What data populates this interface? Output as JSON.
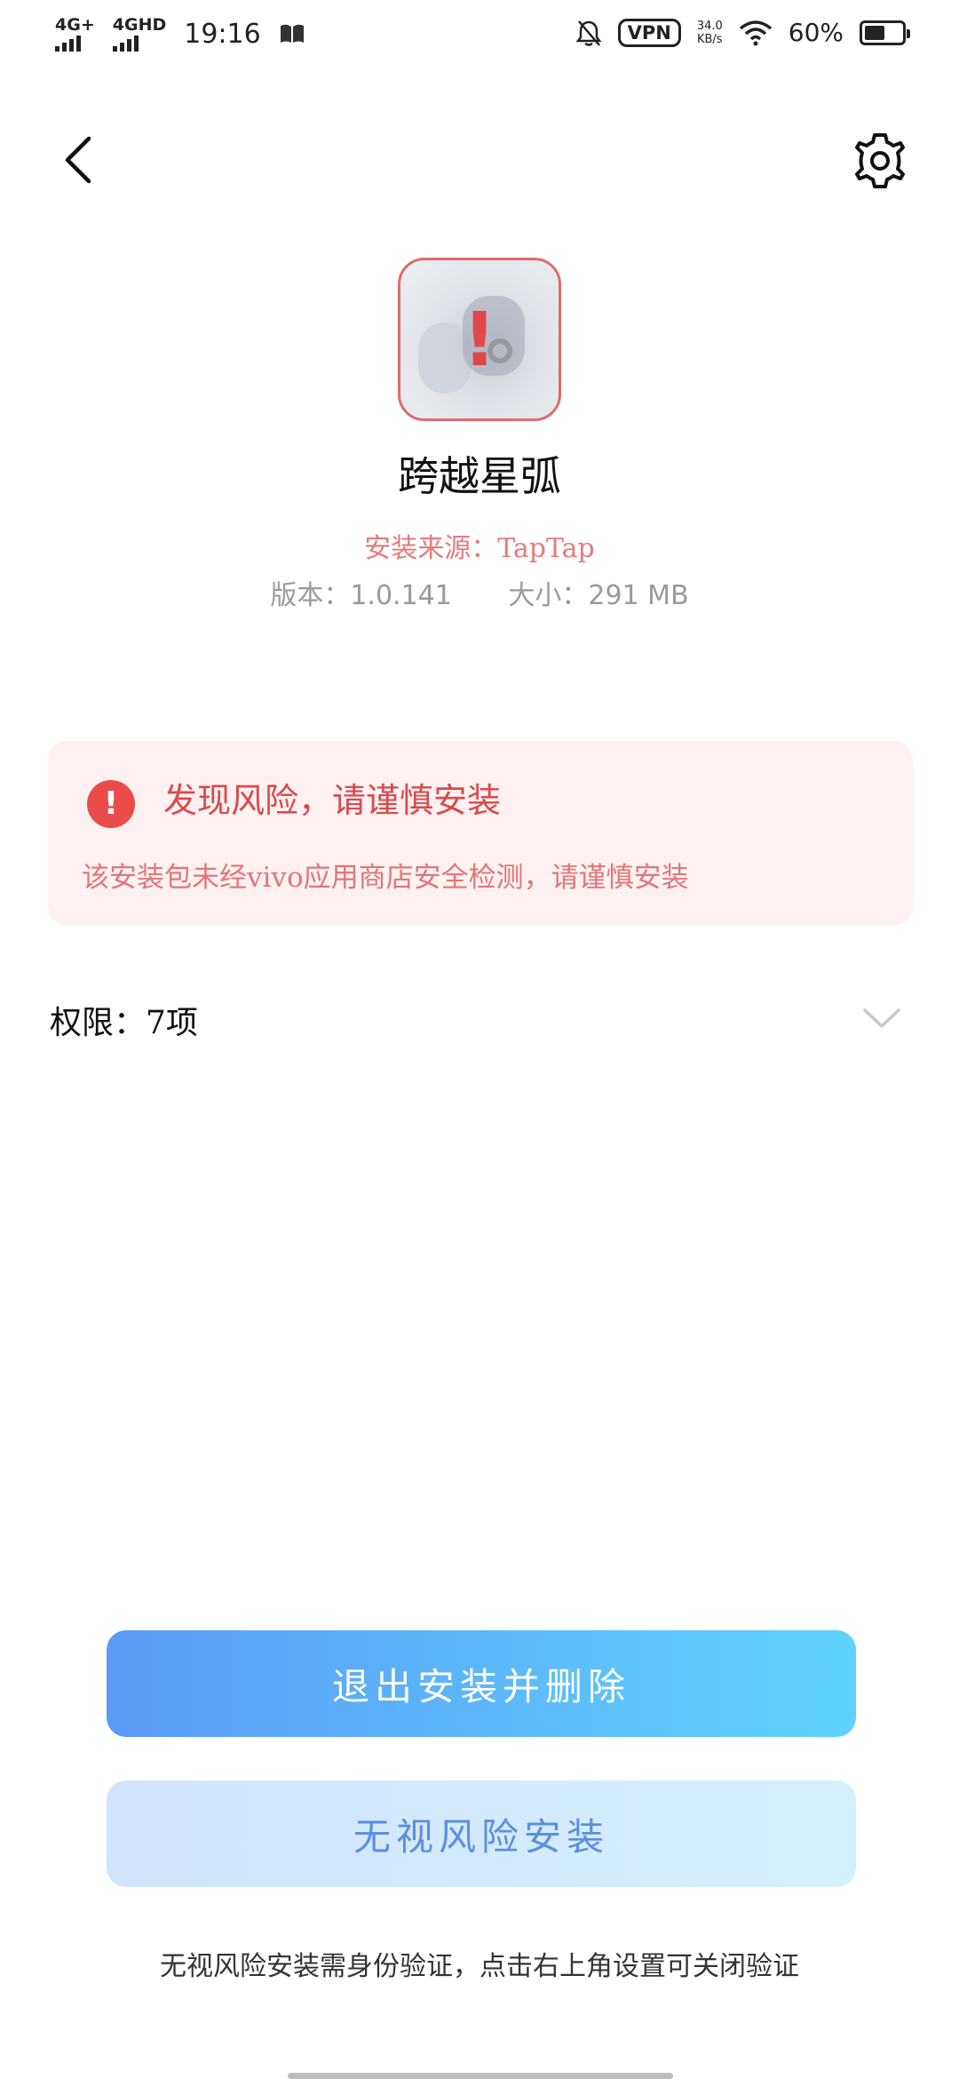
{
  "status_bar": {
    "net1": "4G+",
    "net2": "4GHD",
    "time": "19:16",
    "vpn": "VPN",
    "speed_value": "34.0",
    "speed_unit": "KB/s",
    "battery_percent": "60%",
    "battery_level": 0.6,
    "icons": [
      "book-icon",
      "bell-off-icon",
      "wifi-icon",
      "battery-icon"
    ]
  },
  "nav": {
    "icons": [
      "back-icon",
      "gear-icon"
    ]
  },
  "app": {
    "name": "跨越星弧",
    "source": "安装来源：TapTap",
    "version": "版本：1.0.141",
    "size": "大小：291 MB",
    "icon_badge": "!"
  },
  "warning": {
    "icon": "!",
    "title": "发现风险，请谨慎安装",
    "description": "该安装包未经vivo应用商店安全检测，请谨慎安装",
    "colors": {
      "title": "#d94a4a",
      "background": "#fdf1f1",
      "icon": "#ea4b4b"
    }
  },
  "permissions": {
    "label": "权限：7项"
  },
  "actions": {
    "exit_delete": "退出安装并删除",
    "ignore_install": "无视风险安装",
    "hint": "无视风险安装需身份验证，点击右上角设置可关闭验证"
  }
}
